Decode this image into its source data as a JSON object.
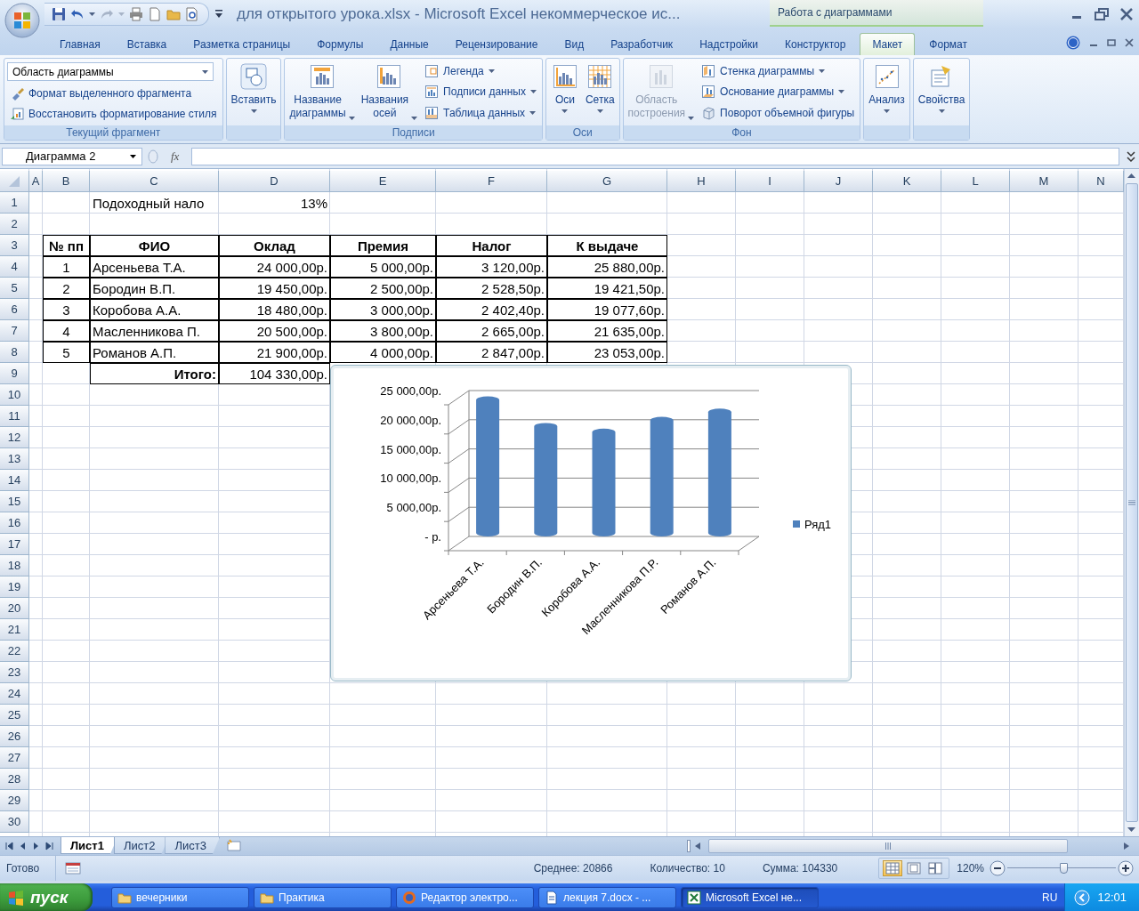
{
  "window": {
    "title": "для открытого урока.xlsx - Microsoft Excel некоммерческое ис...",
    "context_group": "Работа с диаграммами"
  },
  "ribbon_tabs": [
    {
      "label": "Главная",
      "selected": false
    },
    {
      "label": "Вставка",
      "selected": false
    },
    {
      "label": "Разметка страницы",
      "selected": false
    },
    {
      "label": "Формулы",
      "selected": false
    },
    {
      "label": "Данные",
      "selected": false
    },
    {
      "label": "Рецензирование",
      "selected": false
    },
    {
      "label": "Вид",
      "selected": false
    },
    {
      "label": "Разработчик",
      "selected": false
    },
    {
      "label": "Надстройки",
      "selected": false
    },
    {
      "label": "Конструктор",
      "selected": false
    },
    {
      "label": "Макет",
      "selected": true
    },
    {
      "label": "Формат",
      "selected": false
    }
  ],
  "ribbon_groups": [
    {
      "title": "Текущий фрагмент",
      "items": [
        {
          "kind": "dropdown",
          "label": "Область диаграммы"
        },
        {
          "kind": "small",
          "label": "Формат выделенного фрагмента",
          "dropdown": false,
          "disabled": false
        },
        {
          "kind": "small",
          "label": "Восстановить форматирование стиля",
          "dropdown": false,
          "disabled": false
        }
      ]
    },
    {
      "items": [
        {
          "kind": "large",
          "label": "Вставить",
          "dropdown": true,
          "disabled": false
        }
      ]
    },
    {
      "title": "Подписи",
      "items": [
        {
          "kind": "large",
          "label": "Название диаграммы",
          "dropdown": true,
          "disabled": false
        },
        {
          "kind": "large",
          "label": "Названия осей",
          "dropdown": true,
          "disabled": false
        },
        {
          "kind": "small",
          "label": "Легенда",
          "dropdown": true,
          "disabled": false
        },
        {
          "kind": "small",
          "label": "Подписи данных",
          "dropdown": true,
          "disabled": false
        },
        {
          "kind": "small",
          "label": "Таблица данных",
          "dropdown": true,
          "disabled": false
        }
      ]
    },
    {
      "title": "Оси",
      "items": [
        {
          "kind": "large",
          "label": "Оси",
          "dropdown": true,
          "disabled": false
        },
        {
          "kind": "large",
          "label": "Сетка",
          "dropdown": true,
          "disabled": false
        }
      ]
    },
    {
      "title": "Фон",
      "items": [
        {
          "kind": "large",
          "label": "Область построения",
          "dropdown": true,
          "disabled": true
        },
        {
          "kind": "small",
          "label": "Стенка диаграммы",
          "dropdown": true,
          "disabled": false
        },
        {
          "kind": "small",
          "label": "Основание диаграммы",
          "dropdown": true,
          "disabled": false
        },
        {
          "kind": "small",
          "label": "Поворот объемной фигуры",
          "dropdown": false,
          "disabled": false
        }
      ]
    },
    {
      "items": [
        {
          "kind": "large",
          "label": "Анализ",
          "dropdown": true,
          "disabled": false
        }
      ]
    },
    {
      "items": [
        {
          "kind": "large",
          "label": "Свойства",
          "dropdown": true,
          "disabled": false
        }
      ]
    }
  ],
  "formula_bar": {
    "name_box": "Диаграмма 2",
    "function_label": "fx"
  },
  "sheet": {
    "columns": [
      "A",
      "B",
      "C",
      "D",
      "E",
      "F",
      "G",
      "H",
      "I",
      "J",
      "K",
      "L",
      "M",
      "N"
    ],
    "row_headers": [
      "1",
      "2",
      "3",
      "4",
      "5",
      "6",
      "7",
      "8",
      "9",
      "10",
      "11",
      "12",
      "13",
      "14",
      "15",
      "16",
      "17",
      "18",
      "19",
      "20",
      "21",
      "22",
      "23",
      "24",
      "25",
      "26",
      "27",
      "28",
      "29",
      "30"
    ],
    "tax_rate": {
      "label": "Подоходный нало",
      "value": "13%"
    },
    "table": {
      "headers": [
        "№ пп",
        "ФИО",
        "Оклад",
        "Премия",
        "Налог",
        "К выдаче"
      ],
      "rows": [
        [
          "1",
          "Арсеньева Т.А.",
          "24 000,00р.",
          "5 000,00р.",
          "3 120,00р.",
          "25 880,00р."
        ],
        [
          "2",
          "Бородин В.П.",
          "19 450,00р.",
          "2 500,00р.",
          "2 528,50р.",
          "19 421,50р."
        ],
        [
          "3",
          "Коробова А.А.",
          "18 480,00р.",
          "3 000,00р.",
          "2 402,40р.",
          "19 077,60р."
        ],
        [
          "4",
          "Масленникова П.",
          "20 500,00р.",
          "3 800,00р.",
          "2 665,00р.",
          "21 635,00р."
        ],
        [
          "5",
          "Романов А.П.",
          "21 900,00р.",
          "4 000,00р.",
          "2 847,00р.",
          "23 053,00р."
        ]
      ],
      "total": {
        "label": "Итого:",
        "value": "104 330,00р."
      }
    }
  },
  "chart": {
    "chart_data": {
      "type": "bar",
      "categories": [
        "Арсеньева Т.А.",
        "Бородин В.П.",
        "Коробова А.А.",
        "Масленникова П.Р.",
        "Романов А.П."
      ],
      "series": [
        {
          "name": "Ряд1",
          "color": "#4f81bd",
          "values": [
            24000,
            19450,
            18480,
            20500,
            21900
          ]
        }
      ],
      "ylim": [
        0,
        25000
      ],
      "grid": true,
      "yticks": [
        {
          "value": 0,
          "label": "-  р."
        },
        {
          "value": 5000,
          "label": "5 000,00р."
        },
        {
          "value": 10000,
          "label": "10 000,00р."
        },
        {
          "value": 15000,
          "label": "15 000,00р."
        },
        {
          "value": 20000,
          "label": "20 000,00р."
        },
        {
          "value": 25000,
          "label": "25 000,00р."
        }
      ]
    }
  },
  "sheet_tabs": [
    {
      "label": "Лист1",
      "selected": true
    },
    {
      "label": "Лист2",
      "selected": false
    },
    {
      "label": "Лист3",
      "selected": false
    }
  ],
  "status_bar": {
    "mode": "Готово",
    "average": "Среднее: 20866",
    "count": "Количество: 10",
    "sum": "Сумма: 104330",
    "views": [
      {
        "kind": "normal",
        "selected": true
      },
      {
        "kind": "page_layout",
        "selected": false
      },
      {
        "kind": "page_break",
        "selected": false
      }
    ],
    "zoom": "120%",
    "zoom_slider": {
      "level": 0.52
    }
  },
  "taskbar": {
    "start": "пуск",
    "tasks": [
      {
        "kind": "folder",
        "label": "вечерники",
        "selected": false
      },
      {
        "kind": "folder",
        "label": "Практика",
        "selected": false
      },
      {
        "kind": "browser",
        "label": "Редактор электро...",
        "selected": false
      },
      {
        "kind": "document",
        "label": "лекция 7.docx - ...",
        "selected": false
      },
      {
        "kind": "spreadsheet",
        "label": "Microsoft Excel не...",
        "selected": true
      }
    ],
    "language": "RU",
    "clock": "12:01"
  }
}
